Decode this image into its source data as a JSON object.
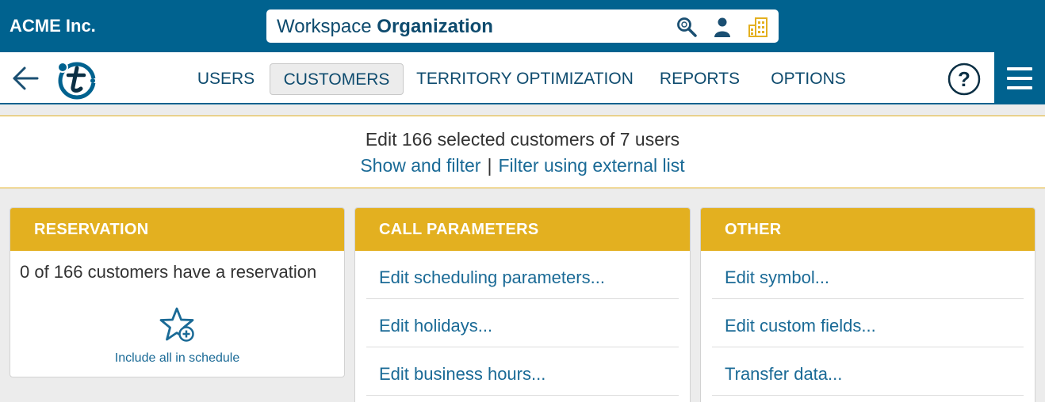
{
  "topbar": {
    "company": "ACME Inc.",
    "workspace_prefix": "Workspace",
    "workspace_name": "Organization",
    "icons": [
      "search-icon",
      "user-icon",
      "building-icon"
    ]
  },
  "nav": {
    "items": [
      {
        "label": "USERS"
      },
      {
        "label": "CUSTOMERS",
        "active": true
      },
      {
        "label": "TERRITORY OPTIMIZATION"
      },
      {
        "label": "REPORTS"
      },
      {
        "label": "OPTIONS"
      }
    ],
    "help_label": "?"
  },
  "summary": {
    "title": "Edit 166 selected customers of 7 users",
    "link_show": "Show and filter",
    "separator": "|",
    "link_external": "Filter using external list"
  },
  "cards": {
    "reservation": {
      "title": "RESERVATION",
      "text": "0 of 166 customers have a reservation",
      "action": "Include all in schedule"
    },
    "call_parameters": {
      "title": "CALL PARAMETERS",
      "links": [
        "Edit scheduling parameters...",
        "Edit holidays...",
        "Edit business hours..."
      ]
    },
    "other": {
      "title": "OTHER",
      "links": [
        "Edit symbol...",
        "Edit custom fields...",
        "Transfer data..."
      ]
    }
  },
  "colors": {
    "brand": "#00628f",
    "accent": "#e3b020",
    "link": "#1a6a96"
  }
}
